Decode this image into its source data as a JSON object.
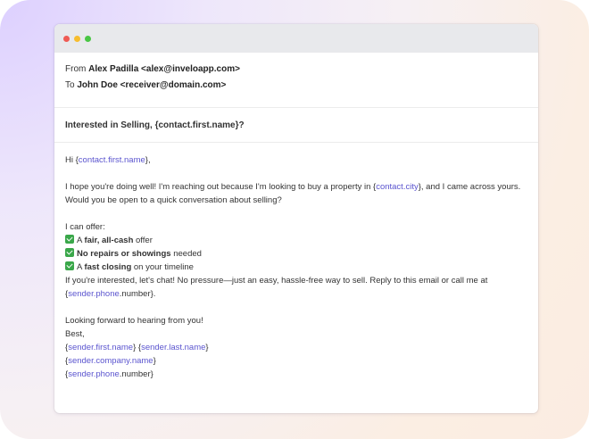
{
  "email": {
    "from_prefix": "From",
    "from_value": "Alex Padilla <alex@inveloapp.com>",
    "to_prefix": "To",
    "to_value": "John Doe <receiver@domain.com>",
    "subject": "Interested in Selling, {contact.first.name}?",
    "greeting": {
      "pre": "Hi {",
      "var": "contact.first.name",
      "post": "},"
    },
    "intro": {
      "part1": "I hope you're doing well! I'm reaching out because I'm looking to buy a property in {",
      "var": "contact.city",
      "part2": "}, and I came across yours. Would you be open to a quick conversation about selling?"
    },
    "offer_heading": "I can offer:",
    "offers": [
      {
        "pre": "A ",
        "bold": "fair, all-cash",
        "post": " offer"
      },
      {
        "pre": "",
        "bold": "No repairs or showings",
        "post": " needed"
      },
      {
        "pre": "A ",
        "bold": "fast closing",
        "post": " on your timeline"
      }
    ],
    "cta": {
      "part1": "If you're interested, let's chat! No pressure—just an easy, hassle-free way to sell. Reply to this email or call me at {",
      "var": "sender.phone",
      "part2": ".number}."
    },
    "closing": "Looking forward to hearing from you!",
    "signoff": "Best,",
    "sig": {
      "first_var": "sender.first.name",
      "last_var": "sender.last.name",
      "company_var": "sender.company.name",
      "phone_var": "sender.phone",
      "phone_suffix": ".number}"
    }
  }
}
